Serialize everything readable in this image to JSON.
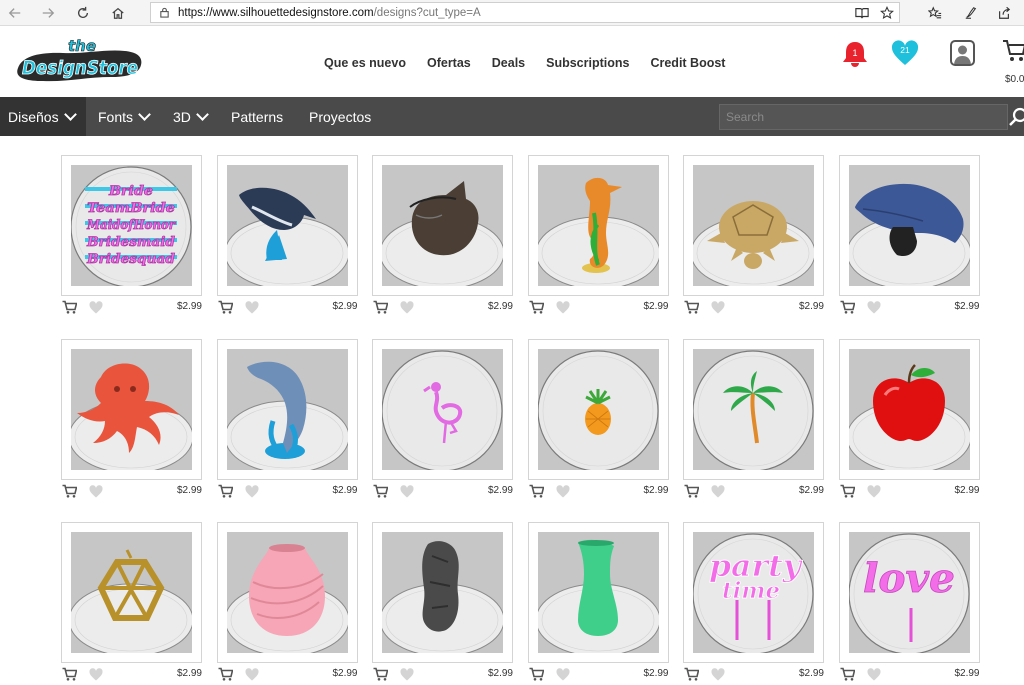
{
  "browser": {
    "url_domain": "https://www.silhouettedesignstore.com",
    "url_path": "/designs?cut_type=A"
  },
  "header": {
    "logo_the": "the",
    "logo_main": "DesignStore",
    "nav": [
      "Que es nuevo",
      "Ofertas",
      "Deals",
      "Subscriptions",
      "Credit Boost"
    ],
    "notification_count": "1",
    "favorites_count": "21",
    "cart_amount": "$0.0"
  },
  "categories": {
    "items": [
      "Diseños",
      "Fonts",
      "3D",
      "Patterns",
      "Proyectos"
    ],
    "search_placeholder": "Search"
  },
  "colors": {
    "notification_red": "#e8232e",
    "favorites_cyan": "#1ec0dc",
    "category_bar": "#4a4a4a"
  },
  "products": [
    {
      "name": "bride-text-set",
      "price": "$2.99"
    },
    {
      "name": "whale",
      "price": "$2.99"
    },
    {
      "name": "rhino",
      "price": "$2.99"
    },
    {
      "name": "seahorse",
      "price": "$2.99"
    },
    {
      "name": "turtle",
      "price": "$2.99"
    },
    {
      "name": "dolphin-head",
      "price": "$2.99"
    },
    {
      "name": "octopus",
      "price": "$2.99"
    },
    {
      "name": "dolphin",
      "price": "$2.99"
    },
    {
      "name": "flamingo",
      "price": "$2.99"
    },
    {
      "name": "pineapple",
      "price": "$2.99"
    },
    {
      "name": "palm-tree",
      "price": "$2.99"
    },
    {
      "name": "apple",
      "price": "$2.99"
    },
    {
      "name": "geometric-pendant",
      "price": "$2.99"
    },
    {
      "name": "spiral-vase",
      "price": "$2.99"
    },
    {
      "name": "rock-sculpture",
      "price": "$2.99"
    },
    {
      "name": "green-vase",
      "price": "$2.99"
    },
    {
      "name": "party-time-topper",
      "price": "$2.99"
    },
    {
      "name": "love-topper",
      "price": "$2.99"
    }
  ],
  "thumb_text": {
    "bride_lines": [
      "Bride",
      "TeamBride",
      "MaidofHonor",
      "Bridesmaid",
      "Bridesquad"
    ],
    "party_line1": "party",
    "party_line2": "time",
    "love": "love"
  }
}
